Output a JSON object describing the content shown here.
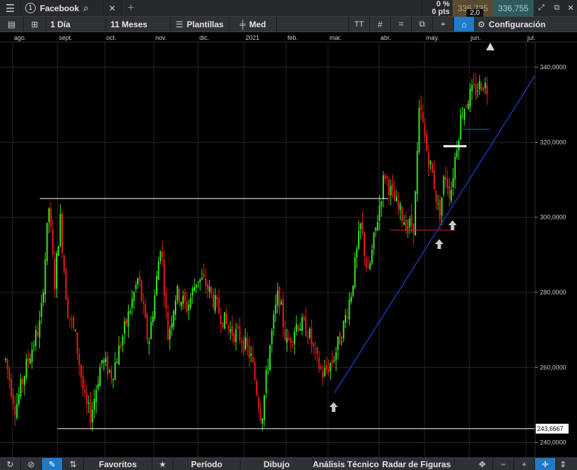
{
  "titlebar": {
    "menu_icon": "hamburger-icon",
    "tab_number": "1",
    "instrument": "Facebook",
    "search_icon": "search-icon",
    "close_icon": "close-icon",
    "add_icon": "plus-icon",
    "change_pct": "0 %",
    "change_pts": "0 pts",
    "sell_price": "336,735",
    "buy_price": "336,755",
    "spread": "2,0",
    "window_icons": [
      "expand-icon",
      "popout-icon",
      "close-window-icon"
    ]
  },
  "toolbar": {
    "interval": "1 Día",
    "range": "11 Meses",
    "templates_label": "Plantillas",
    "chart_type_label": "Med",
    "config_label": "Configuración"
  },
  "bottombar": {
    "favorites_label": "Favoritos",
    "period_label": "Período",
    "drawing_label": "Dibujo",
    "technical_label": "Análisis Técnico",
    "pattern_label": "Radar de Figuras"
  },
  "axis": {
    "y_labels": [
      "340,0000",
      "320,0000",
      "300,0000",
      "280,0000",
      "260,0000",
      "240,0000"
    ],
    "y_values": [
      340,
      320,
      300,
      280,
      260,
      240
    ],
    "months": [
      "ago.",
      "sept.",
      "oct.",
      "nov.",
      "dic.",
      "2021",
      "feb.",
      "mar.",
      "abr.",
      "may.",
      "jun.",
      "jul."
    ],
    "support_label": "243,6667"
  },
  "colors": {
    "up": "#33e61e",
    "down": "#e61a1a",
    "trend": "#2040d8",
    "sell_bg": "#5a4a30",
    "buy_bg": "#2f5a5a"
  },
  "chart_data": {
    "type": "candlestick",
    "ylim": [
      236,
      346
    ],
    "support_level": 243.6667,
    "resistance_level": 305,
    "description_series": [
      {
        "name": "",
        "values": []
      }
    ]
  }
}
